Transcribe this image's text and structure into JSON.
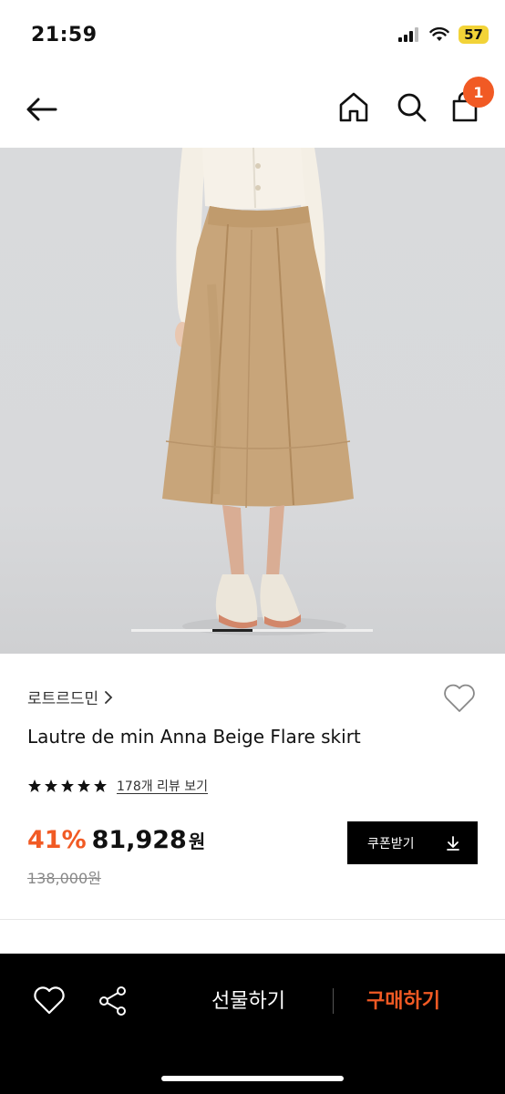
{
  "status": {
    "time": "21:59",
    "battery": "57"
  },
  "nav": {
    "cart_count": "1"
  },
  "product": {
    "brand": "로트르드민",
    "title": "Lautre de min Anna Beige Flare skirt",
    "review_link": "178개 리뷰 보기",
    "rating_stars": 5,
    "discount": "41%",
    "price": "81,928",
    "price_unit": "원",
    "original_price": "138,000원",
    "image_page_index": 2,
    "image_page_total": 6
  },
  "coupon": {
    "label": "쿠폰받기"
  },
  "bottom": {
    "gift_label": "선물하기",
    "buy_label": "구매하기"
  },
  "colors": {
    "accent": "#f15a24",
    "dark": "#000000",
    "battery": "#f2d338"
  },
  "icons": [
    "back-arrow-icon",
    "home-icon",
    "search-icon",
    "cart-icon",
    "heart-icon",
    "share-icon",
    "download-icon",
    "chevron-right-icon",
    "star-icon"
  ]
}
